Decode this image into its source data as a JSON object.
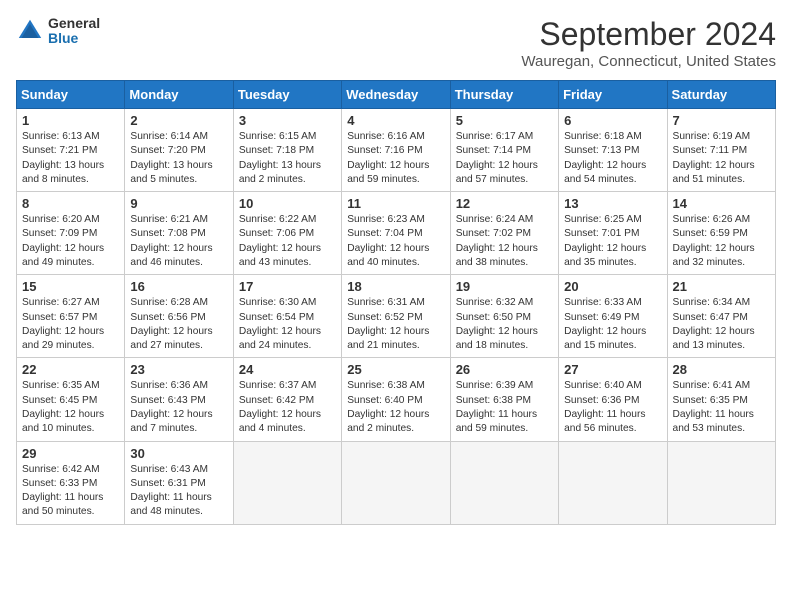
{
  "header": {
    "logo_general": "General",
    "logo_blue": "Blue",
    "month_title": "September 2024",
    "location": "Wauregan, Connecticut, United States"
  },
  "weekdays": [
    "Sunday",
    "Monday",
    "Tuesday",
    "Wednesday",
    "Thursday",
    "Friday",
    "Saturday"
  ],
  "weeks": [
    [
      {
        "day": 1,
        "info": "Sunrise: 6:13 AM\nSunset: 7:21 PM\nDaylight: 13 hours\nand 8 minutes."
      },
      {
        "day": 2,
        "info": "Sunrise: 6:14 AM\nSunset: 7:20 PM\nDaylight: 13 hours\nand 5 minutes."
      },
      {
        "day": 3,
        "info": "Sunrise: 6:15 AM\nSunset: 7:18 PM\nDaylight: 13 hours\nand 2 minutes."
      },
      {
        "day": 4,
        "info": "Sunrise: 6:16 AM\nSunset: 7:16 PM\nDaylight: 12 hours\nand 59 minutes."
      },
      {
        "day": 5,
        "info": "Sunrise: 6:17 AM\nSunset: 7:14 PM\nDaylight: 12 hours\nand 57 minutes."
      },
      {
        "day": 6,
        "info": "Sunrise: 6:18 AM\nSunset: 7:13 PM\nDaylight: 12 hours\nand 54 minutes."
      },
      {
        "day": 7,
        "info": "Sunrise: 6:19 AM\nSunset: 7:11 PM\nDaylight: 12 hours\nand 51 minutes."
      }
    ],
    [
      {
        "day": 8,
        "info": "Sunrise: 6:20 AM\nSunset: 7:09 PM\nDaylight: 12 hours\nand 49 minutes."
      },
      {
        "day": 9,
        "info": "Sunrise: 6:21 AM\nSunset: 7:08 PM\nDaylight: 12 hours\nand 46 minutes."
      },
      {
        "day": 10,
        "info": "Sunrise: 6:22 AM\nSunset: 7:06 PM\nDaylight: 12 hours\nand 43 minutes."
      },
      {
        "day": 11,
        "info": "Sunrise: 6:23 AM\nSunset: 7:04 PM\nDaylight: 12 hours\nand 40 minutes."
      },
      {
        "day": 12,
        "info": "Sunrise: 6:24 AM\nSunset: 7:02 PM\nDaylight: 12 hours\nand 38 minutes."
      },
      {
        "day": 13,
        "info": "Sunrise: 6:25 AM\nSunset: 7:01 PM\nDaylight: 12 hours\nand 35 minutes."
      },
      {
        "day": 14,
        "info": "Sunrise: 6:26 AM\nSunset: 6:59 PM\nDaylight: 12 hours\nand 32 minutes."
      }
    ],
    [
      {
        "day": 15,
        "info": "Sunrise: 6:27 AM\nSunset: 6:57 PM\nDaylight: 12 hours\nand 29 minutes."
      },
      {
        "day": 16,
        "info": "Sunrise: 6:28 AM\nSunset: 6:56 PM\nDaylight: 12 hours\nand 27 minutes."
      },
      {
        "day": 17,
        "info": "Sunrise: 6:30 AM\nSunset: 6:54 PM\nDaylight: 12 hours\nand 24 minutes."
      },
      {
        "day": 18,
        "info": "Sunrise: 6:31 AM\nSunset: 6:52 PM\nDaylight: 12 hours\nand 21 minutes."
      },
      {
        "day": 19,
        "info": "Sunrise: 6:32 AM\nSunset: 6:50 PM\nDaylight: 12 hours\nand 18 minutes."
      },
      {
        "day": 20,
        "info": "Sunrise: 6:33 AM\nSunset: 6:49 PM\nDaylight: 12 hours\nand 15 minutes."
      },
      {
        "day": 21,
        "info": "Sunrise: 6:34 AM\nSunset: 6:47 PM\nDaylight: 12 hours\nand 13 minutes."
      }
    ],
    [
      {
        "day": 22,
        "info": "Sunrise: 6:35 AM\nSunset: 6:45 PM\nDaylight: 12 hours\nand 10 minutes."
      },
      {
        "day": 23,
        "info": "Sunrise: 6:36 AM\nSunset: 6:43 PM\nDaylight: 12 hours\nand 7 minutes."
      },
      {
        "day": 24,
        "info": "Sunrise: 6:37 AM\nSunset: 6:42 PM\nDaylight: 12 hours\nand 4 minutes."
      },
      {
        "day": 25,
        "info": "Sunrise: 6:38 AM\nSunset: 6:40 PM\nDaylight: 12 hours\nand 2 minutes."
      },
      {
        "day": 26,
        "info": "Sunrise: 6:39 AM\nSunset: 6:38 PM\nDaylight: 11 hours\nand 59 minutes."
      },
      {
        "day": 27,
        "info": "Sunrise: 6:40 AM\nSunset: 6:36 PM\nDaylight: 11 hours\nand 56 minutes."
      },
      {
        "day": 28,
        "info": "Sunrise: 6:41 AM\nSunset: 6:35 PM\nDaylight: 11 hours\nand 53 minutes."
      }
    ],
    [
      {
        "day": 29,
        "info": "Sunrise: 6:42 AM\nSunset: 6:33 PM\nDaylight: 11 hours\nand 50 minutes."
      },
      {
        "day": 30,
        "info": "Sunrise: 6:43 AM\nSunset: 6:31 PM\nDaylight: 11 hours\nand 48 minutes."
      },
      null,
      null,
      null,
      null,
      null
    ]
  ]
}
